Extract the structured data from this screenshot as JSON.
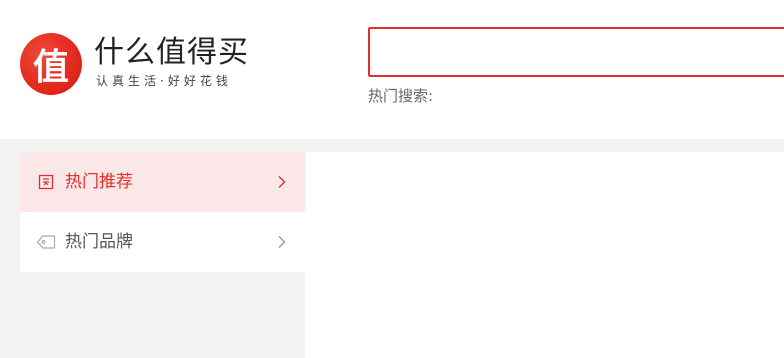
{
  "brand": {
    "logo_char": "值",
    "title": "什么值得买",
    "slogan": "认真生活·好好花钱",
    "accent_color": "#e0302a"
  },
  "search": {
    "value": "",
    "placeholder": "",
    "hot_label": "热门搜索:"
  },
  "sidebar": {
    "items": [
      {
        "label": "热门推荐",
        "icon": "recommend-icon",
        "active": true
      },
      {
        "label": "热门品牌",
        "icon": "tag-icon",
        "active": false
      }
    ]
  }
}
